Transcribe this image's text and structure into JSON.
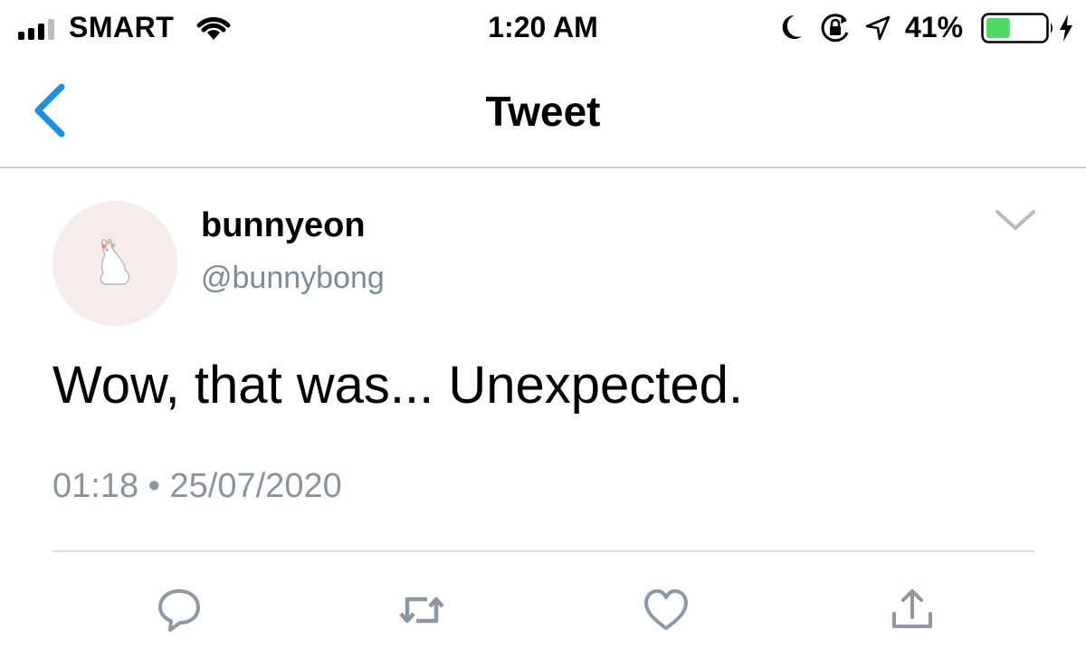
{
  "status_bar": {
    "carrier": "SMART",
    "time": "1:20 AM",
    "battery_percent": "41%",
    "battery_level": 0.41,
    "battery_color": "#4cd964",
    "icons": [
      "signal-icon",
      "wifi-icon",
      "do-not-disturb-moon-icon",
      "rotation-lock-icon",
      "location-arrow-icon",
      "battery-icon",
      "charging-bolt-icon"
    ]
  },
  "nav": {
    "title": "Tweet",
    "back_icon": "chevron-left-icon",
    "accent_color": "#1d8ee0"
  },
  "tweet": {
    "display_name": "bunnyeon",
    "handle": "@bunnybong",
    "text": "Wow, that was... Unexpected.",
    "time": "01:18",
    "separator": "•",
    "date": "25/07/2020",
    "more_icon": "chevron-down-icon"
  },
  "actions": [
    {
      "icon": "reply-icon"
    },
    {
      "icon": "retweet-icon"
    },
    {
      "icon": "like-heart-icon"
    },
    {
      "icon": "share-icon"
    }
  ],
  "colors": {
    "secondary_text": "#8a949c",
    "action_icon": "#8d98a3",
    "divider": "#dcdcdc"
  }
}
